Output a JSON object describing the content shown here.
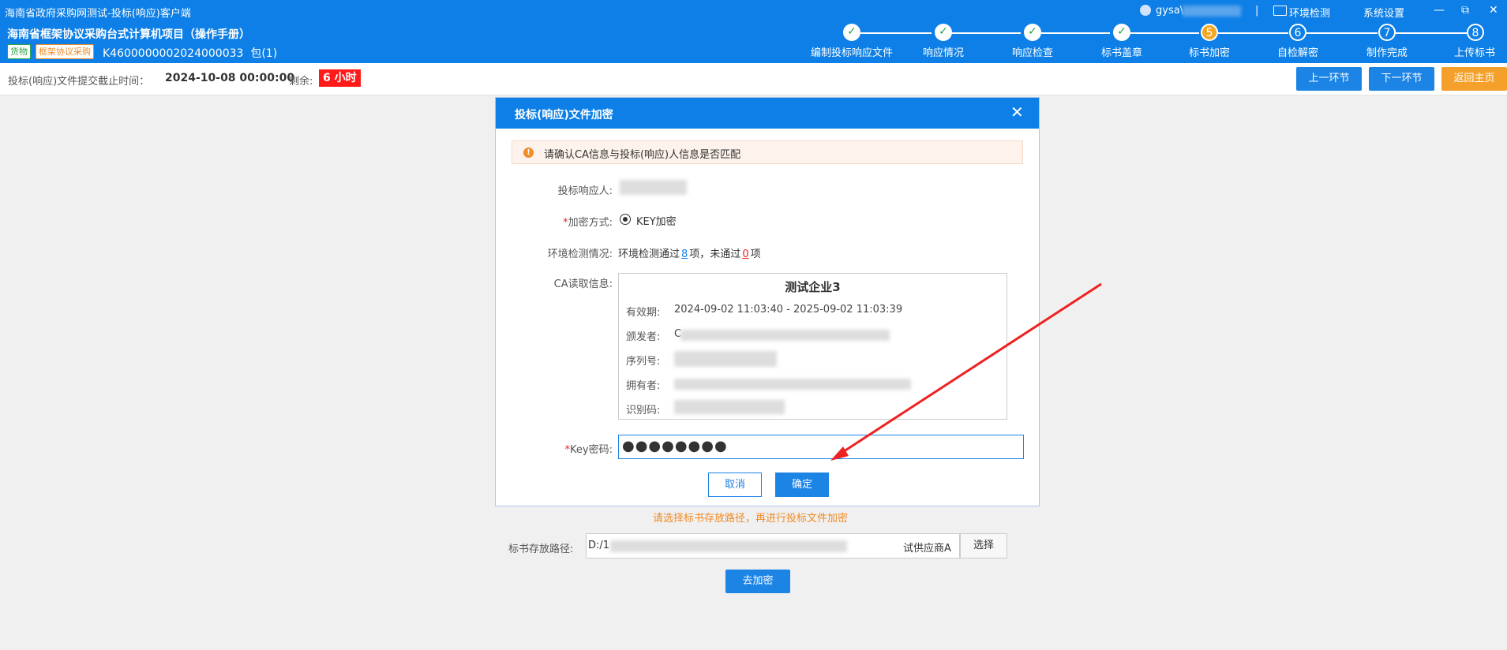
{
  "window": {
    "title": "海南省政府采购网测试-投标(响应)客户端"
  },
  "header": {
    "project_title": "海南省框架协议采购台式计算机项目（操作手册）",
    "tag_goods": "货物",
    "tag_frame": "框架协议采购",
    "project_code": "K4600000002024000033",
    "package": "包(1)",
    "user": "gysa\\",
    "env_check": "环境检测",
    "divider": "|",
    "settings": "系统设置",
    "win_min": "—",
    "win_restore": "⧉",
    "win_close": "✕"
  },
  "steps": [
    {
      "index": "✓",
      "label": "编制投标响应文件",
      "state": "done"
    },
    {
      "index": "✓",
      "label": "响应情况",
      "state": "done"
    },
    {
      "index": "✓",
      "label": "响应检查",
      "state": "done"
    },
    {
      "index": "✓",
      "label": "标书盖章",
      "state": "done"
    },
    {
      "index": "5",
      "label": "标书加密",
      "state": "active"
    },
    {
      "index": "6",
      "label": "自检解密",
      "state": "todo"
    },
    {
      "index": "7",
      "label": "制作完成",
      "state": "todo"
    },
    {
      "index": "8",
      "label": "上传标书",
      "state": "todo"
    }
  ],
  "deadline": {
    "label": "投标(响应)文件提交截止时间：",
    "value": "2024-10-08 00:00:00",
    "remaining_label": "剩余:",
    "remaining_value": "6 小时"
  },
  "nav": {
    "prev": "上一环节",
    "next": "下一环节",
    "home": "返回主页"
  },
  "dialog": {
    "title": "投标(响应)文件加密",
    "close": "✕",
    "warning": "请确认CA信息与投标(响应)人信息是否匹配",
    "bidder_label": "投标响应人:",
    "encrypt_label": "加密方式:",
    "encrypt_option": "KEY加密",
    "env_label": "环境检测情况:",
    "env_text_1": "环境检测通过",
    "env_pass": "8",
    "env_text_2": "项，未通过",
    "env_fail": "0",
    "env_text_3": "项",
    "ca_label": "CA读取信息:",
    "ca": {
      "name": "测试企业3",
      "validity_label": "有效期:",
      "validity": "2024-09-02 11:03:40 - 2025-09-02 11:03:39",
      "issuer_label": "颁发者:",
      "issuer_prefix": "C",
      "serial_label": "序列号:",
      "owner_label": "拥有者:",
      "id_label": "识别码:"
    },
    "key_label": "Key密码:",
    "key_value": "●●●●●●●●",
    "cancel": "取消",
    "ok": "确定"
  },
  "hint": "请选择标书存放路径，再进行投标文件加密",
  "path": {
    "label": "标书存放路径:",
    "prefix": "D:/1",
    "suffix": "试供应商A",
    "choose": "选择"
  },
  "encrypt_button": "去加密",
  "colors": {
    "brand": "#0d7fe6",
    "accent_orange": "#f5a02a",
    "done_green": "#22a33a",
    "danger": "#ff1a1a"
  }
}
